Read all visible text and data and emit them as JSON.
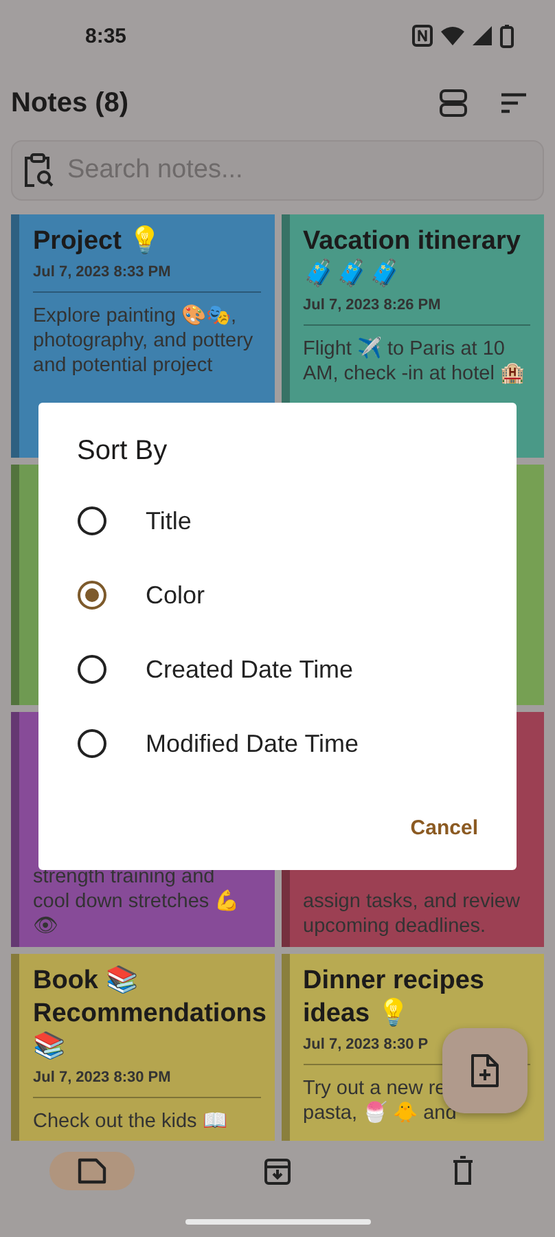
{
  "status_bar": {
    "time": "8:35"
  },
  "header": {
    "title": "Notes (8)"
  },
  "search": {
    "placeholder": "Search notes..."
  },
  "notes": [
    {
      "title_lines": [
        "Project 💡"
      ],
      "date": "Jul 7, 2023 8:33 PM",
      "body_lines": [
        "Explore painting 🎨🎭,",
        "photography, and pottery",
        "and potential project"
      ],
      "color": "#3e80ad"
    },
    {
      "title_lines": [
        "Vacation itinerary",
        "🧳🧳🧳"
      ],
      "date": "Jul 7, 2023 8:26 PM",
      "body_lines": [
        "Flight ✈️ to Paris at 10",
        "AM, check -in at hotel 🏨"
      ],
      "color": "#4a9987"
    },
    {
      "color": "#6f9a52"
    },
    {
      "color": "#76a053"
    },
    {
      "body_lines": [
        "strength training and",
        "cool down stretches 💪",
        "👁"
      ],
      "color": "#874b98"
    },
    {
      "body_lines": [
        "assign tasks, and review",
        "upcoming deadlines."
      ],
      "color": "#9c4053"
    },
    {
      "title_lines": [
        "Book 📚",
        "Recommendations",
        "📚"
      ],
      "date": "Jul 7, 2023 8:30 PM",
      "body_lines": [
        "Check out the kids 📖"
      ],
      "color": "#b5a54f"
    },
    {
      "title_lines": [
        "Dinner recipes",
        "ideas 💡"
      ],
      "date": "Jul 7, 2023 8:30 P",
      "body_lines": [
        "Try out a new re",
        "pasta, 🍧 🐥 and"
      ],
      "color": "#b8aa52"
    }
  ],
  "bottom_nav": [
    {
      "kind": "notes",
      "selected": true
    },
    {
      "kind": "archive",
      "selected": false
    },
    {
      "kind": "trash",
      "selected": false
    }
  ],
  "dialog": {
    "title": "Sort By",
    "options": [
      {
        "label": "Title",
        "selected": false
      },
      {
        "label": "Color",
        "selected": true
      },
      {
        "label": "Created Date Time",
        "selected": false
      },
      {
        "label": "Modified Date Time",
        "selected": false
      }
    ],
    "cancel": "Cancel"
  }
}
